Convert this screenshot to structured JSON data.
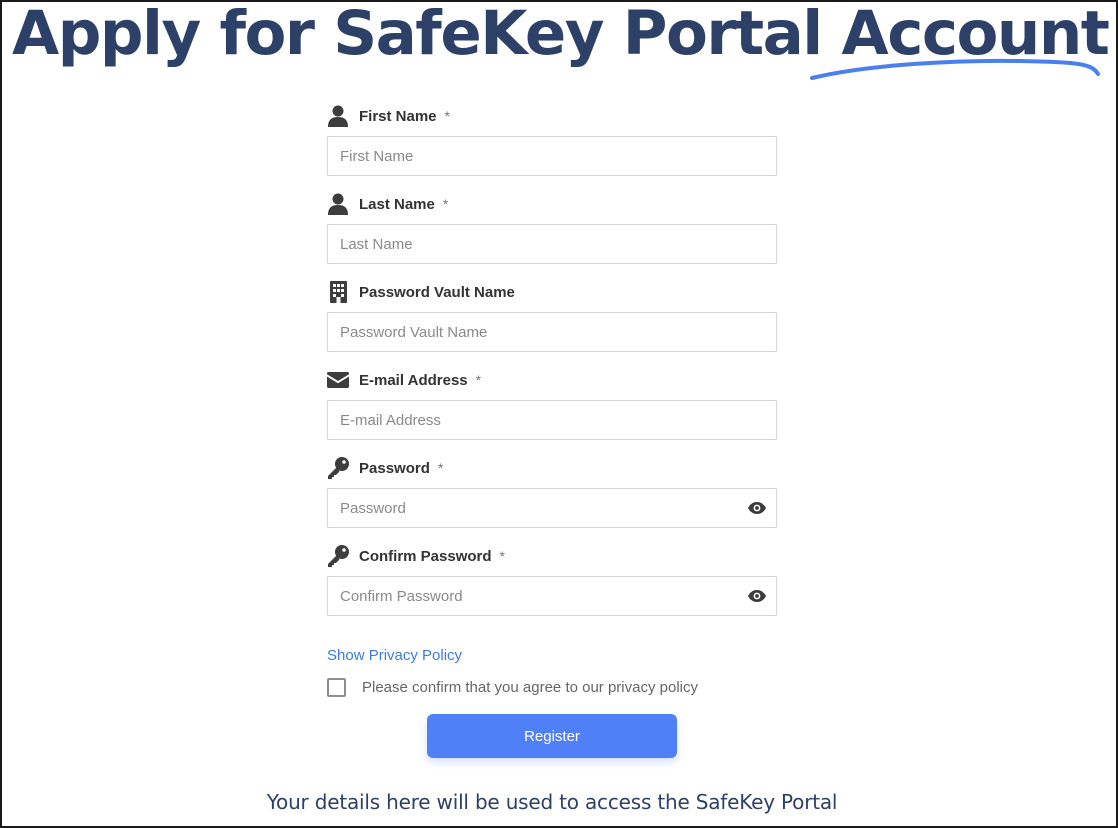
{
  "header": {
    "title_prefix": "Apply for SafeKey Portal",
    "title_accent": "Account",
    "accent_underline_color": "#4a7ff0",
    "title_color": "#2d4168"
  },
  "form": {
    "required_marker": "*",
    "fields": [
      {
        "id": "first_name",
        "label": "First Name",
        "required": true,
        "placeholder": "First Name",
        "value": "",
        "icon": "user-icon"
      },
      {
        "id": "last_name",
        "label": "Last Name",
        "required": true,
        "placeholder": "Last Name",
        "value": "",
        "icon": "user-icon"
      },
      {
        "id": "vault_name",
        "label": "Password Vault Name",
        "required": false,
        "placeholder": "Password Vault Name",
        "value": "",
        "icon": "building-icon"
      },
      {
        "id": "email",
        "label": "E-mail Address",
        "required": true,
        "placeholder": "E-mail Address",
        "value": "",
        "icon": "envelope-icon"
      },
      {
        "id": "password",
        "label": "Password",
        "required": true,
        "placeholder": "Password",
        "value": "",
        "icon": "key-icon",
        "toggle_icon": "eye-icon"
      },
      {
        "id": "confirm_password",
        "label": "Confirm Password",
        "required": true,
        "placeholder": "Confirm Password",
        "value": "",
        "icon": "key-icon",
        "toggle_icon": "eye-icon"
      }
    ],
    "privacy_link": "Show Privacy Policy",
    "privacy_checkbox_label": "Please confirm that you agree to our privacy policy",
    "privacy_checked": false,
    "register_label": "Register"
  },
  "footer": {
    "note": "Your details here will be used to access the SafeKey Portal"
  },
  "colors": {
    "accent": "#5080f8",
    "link": "#3b7ddd",
    "icon": "#3d3d3d"
  }
}
